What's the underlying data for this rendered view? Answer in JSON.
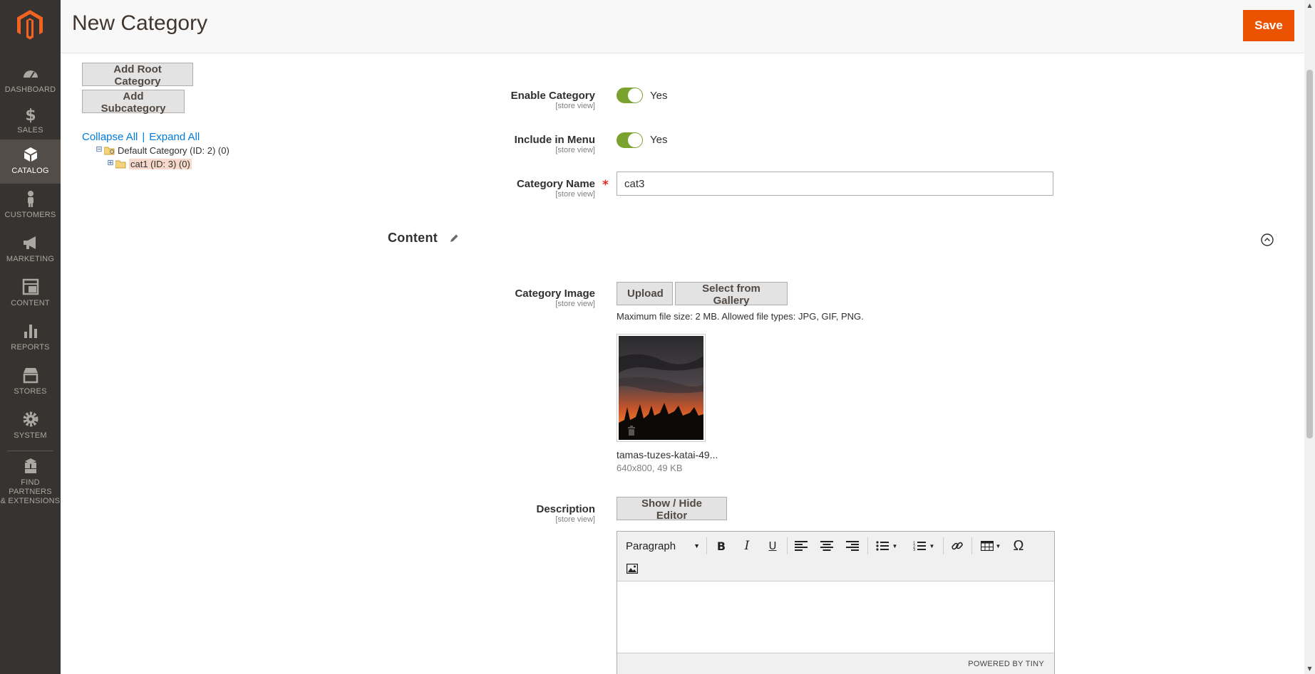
{
  "header": {
    "title": "New Category",
    "save_label": "Save"
  },
  "sidebar": {
    "items": [
      {
        "label": "DASHBOARD",
        "icon": "dashboard-icon"
      },
      {
        "label": "SALES",
        "icon": "dollar-icon"
      },
      {
        "label": "CATALOG",
        "icon": "box-icon",
        "active": true
      },
      {
        "label": "CUSTOMERS",
        "icon": "person-icon"
      },
      {
        "label": "MARKETING",
        "icon": "megaphone-icon"
      },
      {
        "label": "CONTENT",
        "icon": "layout-icon"
      },
      {
        "label": "REPORTS",
        "icon": "bar-chart-icon"
      },
      {
        "label": "STORES",
        "icon": "store-icon"
      },
      {
        "label": "SYSTEM",
        "icon": "gear-icon"
      },
      {
        "label_line1": "FIND PARTNERS",
        "label_line2": "& EXTENSIONS",
        "icon": "boxes-icon"
      }
    ]
  },
  "tree": {
    "add_root_label": "Add Root Category",
    "add_sub_label": "Add Subcategory",
    "collapse_all": "Collapse All",
    "separator": "|",
    "expand_all": "Expand All",
    "nodes": [
      {
        "label": "Default Category (ID: 2) (0)",
        "toggle": "⊟"
      },
      {
        "label": "cat1 (ID: 3) (0)",
        "toggle": "⊞",
        "selected": true
      }
    ]
  },
  "form": {
    "scope_label": "[store view]",
    "enable_category": {
      "label": "Enable Category",
      "value": "Yes"
    },
    "include_in_menu": {
      "label": "Include in Menu",
      "value": "Yes"
    },
    "category_name": {
      "label": "Category Name",
      "value": "cat3",
      "required_mark": "*"
    }
  },
  "content_section": {
    "title": "Content",
    "category_image": {
      "label": "Category Image",
      "upload_label": "Upload",
      "gallery_label": "Select from Gallery",
      "note": "Maximum file size: 2 MB. Allowed file types: JPG, GIF, PNG.",
      "file_name": "tamas-tuzes-katai-49...",
      "file_meta": "640x800, 49 KB"
    },
    "description": {
      "label": "Description",
      "toggle_editor_label": "Show / Hide Editor",
      "format_select": "Paragraph",
      "bold": "B",
      "italic": "I",
      "underline": "U",
      "special_char": "Ω",
      "powered_by": "POWERED BY TINY"
    }
  },
  "colors": {
    "accent": "#eb5202",
    "sidebar_bg": "#373330",
    "toggle_on": "#79a22e",
    "link": "#007bdb"
  }
}
